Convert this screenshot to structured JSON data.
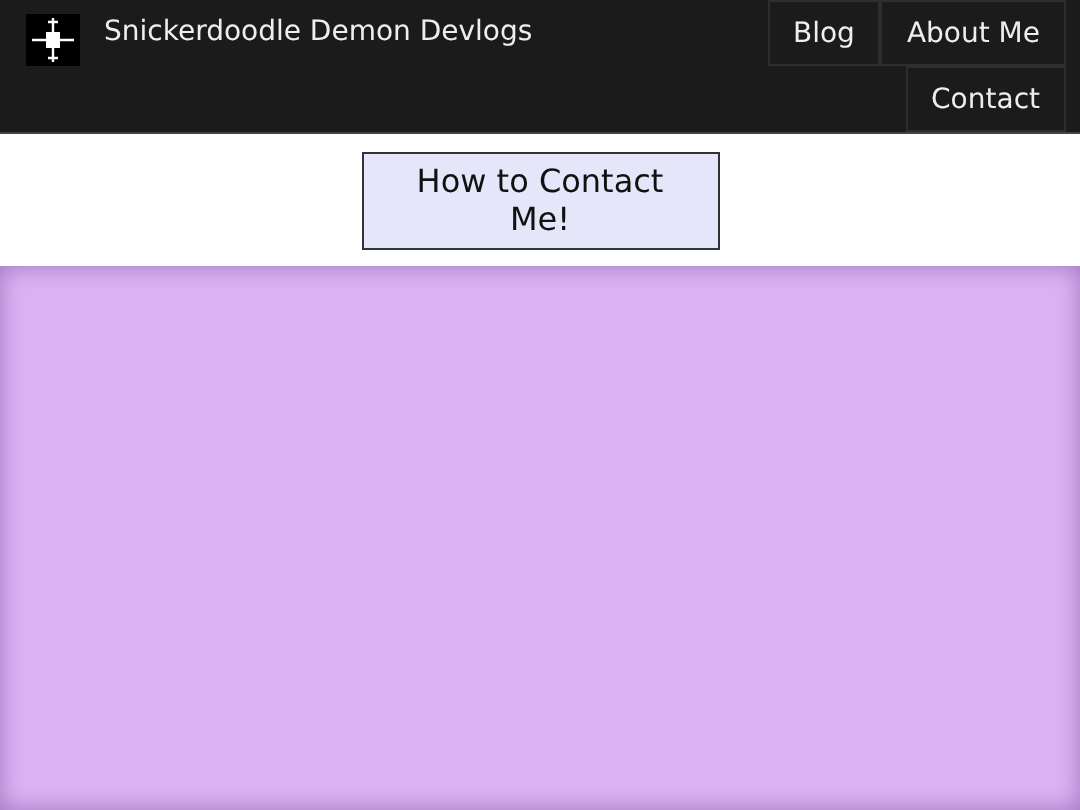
{
  "header": {
    "title": "Snickerdoodle Demon Devlogs"
  },
  "nav": [
    {
      "label": "Blog"
    },
    {
      "label": "About Me"
    },
    {
      "label": "Contact"
    }
  ],
  "heading": {
    "label": "How to Contact Me!"
  }
}
